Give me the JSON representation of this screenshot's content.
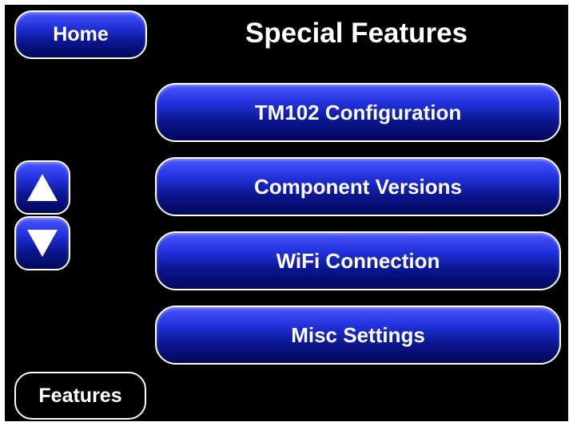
{
  "header": {
    "home_label": "Home",
    "title": "Special Features"
  },
  "menu": {
    "items": [
      {
        "label": "TM102 Configuration"
      },
      {
        "label": "Component Versions"
      },
      {
        "label": "WiFi Connection"
      },
      {
        "label": "Misc Settings"
      }
    ]
  },
  "scroll": {
    "up_icon": "triangle-up-icon",
    "down_icon": "triangle-down-icon"
  },
  "footer": {
    "features_label": "Features"
  },
  "colors": {
    "background": "#000000",
    "button_blue": "#1a24c8",
    "button_border": "#ffffff",
    "text": "#ffffff"
  }
}
